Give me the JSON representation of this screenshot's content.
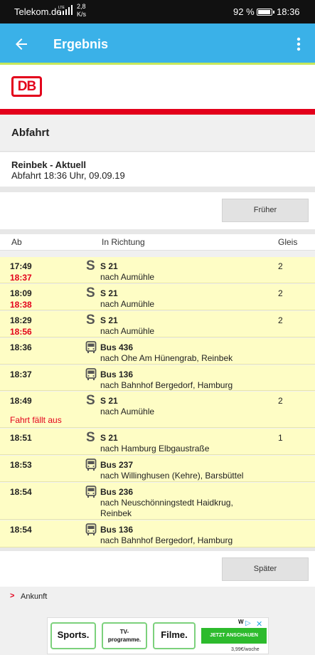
{
  "status_bar": {
    "carrier": "Telekom.de",
    "network": "LTE",
    "speed_value": "2,8",
    "speed_unit": "K/s",
    "battery": "92 %",
    "time": "18:36"
  },
  "app_bar": {
    "title": "Ergebnis",
    "back_icon": "arrow-left-icon",
    "menu_icon": "more-vert-icon",
    "accent": "#3ab1e8"
  },
  "logo": {
    "text": "DB",
    "color": "#e3001b"
  },
  "section_title": "Abfahrt",
  "info": {
    "station": "Reinbek - Aktuell",
    "departure": "Abfahrt 18:36 Uhr, 09.09.19"
  },
  "buttons": {
    "earlier": "Früher",
    "later": "Später"
  },
  "table": {
    "headers": {
      "from": "Ab",
      "direction": "In Richtung",
      "track": "Gleis"
    },
    "rows": [
      {
        "time": "17:49",
        "delay": "18:37",
        "icon": "s-bahn-icon",
        "line": "S 21",
        "direction": "nach Aumühle",
        "track": "2",
        "note": ""
      },
      {
        "time": "18:09",
        "delay": "18:38",
        "icon": "s-bahn-icon",
        "line": "S 21",
        "direction": "nach Aumühle",
        "track": "2",
        "note": ""
      },
      {
        "time": "18:29",
        "delay": "18:56",
        "icon": "s-bahn-icon",
        "line": "S 21",
        "direction": "nach Aumühle",
        "track": "2",
        "note": ""
      },
      {
        "time": "18:36",
        "delay": "",
        "icon": "bus-icon",
        "line": "Bus 436",
        "direction": "nach Ohe Am Hünengrab, Reinbek",
        "track": "",
        "note": ""
      },
      {
        "time": "18:37",
        "delay": "",
        "icon": "bus-icon",
        "line": "Bus 136",
        "direction": "nach Bahnhof Bergedorf, Hamburg",
        "track": "",
        "note": ""
      },
      {
        "time": "18:49",
        "delay": "",
        "icon": "s-bahn-icon",
        "line": "S 21",
        "direction": "nach Aumühle",
        "track": "2",
        "note": "Fahrt fällt aus"
      },
      {
        "time": "18:51",
        "delay": "",
        "icon": "s-bahn-icon",
        "line": "S 21",
        "direction": "nach Hamburg Elbgaustraße",
        "track": "1",
        "note": ""
      },
      {
        "time": "18:53",
        "delay": "",
        "icon": "bus-icon",
        "line": "Bus 237",
        "direction": "nach Willinghusen (Kehre), Barsbüttel",
        "track": "",
        "note": ""
      },
      {
        "time": "18:54",
        "delay": "",
        "icon": "bus-icon",
        "line": "Bus 236",
        "direction": "nach Neuschönningstedt Haidkrug, Reinbek",
        "track": "",
        "note": ""
      },
      {
        "time": "18:54",
        "delay": "",
        "icon": "bus-icon",
        "line": "Bus 136",
        "direction": "nach Bahnhof Bergedorf, Hamburg",
        "track": "",
        "note": ""
      }
    ]
  },
  "arrival_link": "Ankunft",
  "ad": {
    "tile1": "Sports.",
    "tile2_line1": "TV-",
    "tile2_line2": "programme.",
    "tile3": "Filme.",
    "cta": "JETZT ANSCHAUEN",
    "price": "3,99€/woche",
    "brand_mark": "W",
    "close": "✕"
  }
}
